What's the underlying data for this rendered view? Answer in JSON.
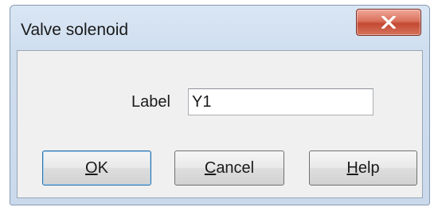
{
  "window": {
    "title": "Valve solenoid"
  },
  "titlebar": {
    "close_icon": "close-x-icon"
  },
  "form": {
    "label_caption": "Label",
    "label_value": "Y1"
  },
  "buttons": {
    "ok": {
      "mnemonic": "O",
      "rest": "K"
    },
    "cancel": {
      "mnemonic": "C",
      "rest": "ancel"
    },
    "help": {
      "mnemonic": "H",
      "rest": "elp"
    }
  },
  "colors": {
    "close_button": "#c44a34",
    "frame": "#cad9ec",
    "default_button_border": "#2e6ea6"
  }
}
